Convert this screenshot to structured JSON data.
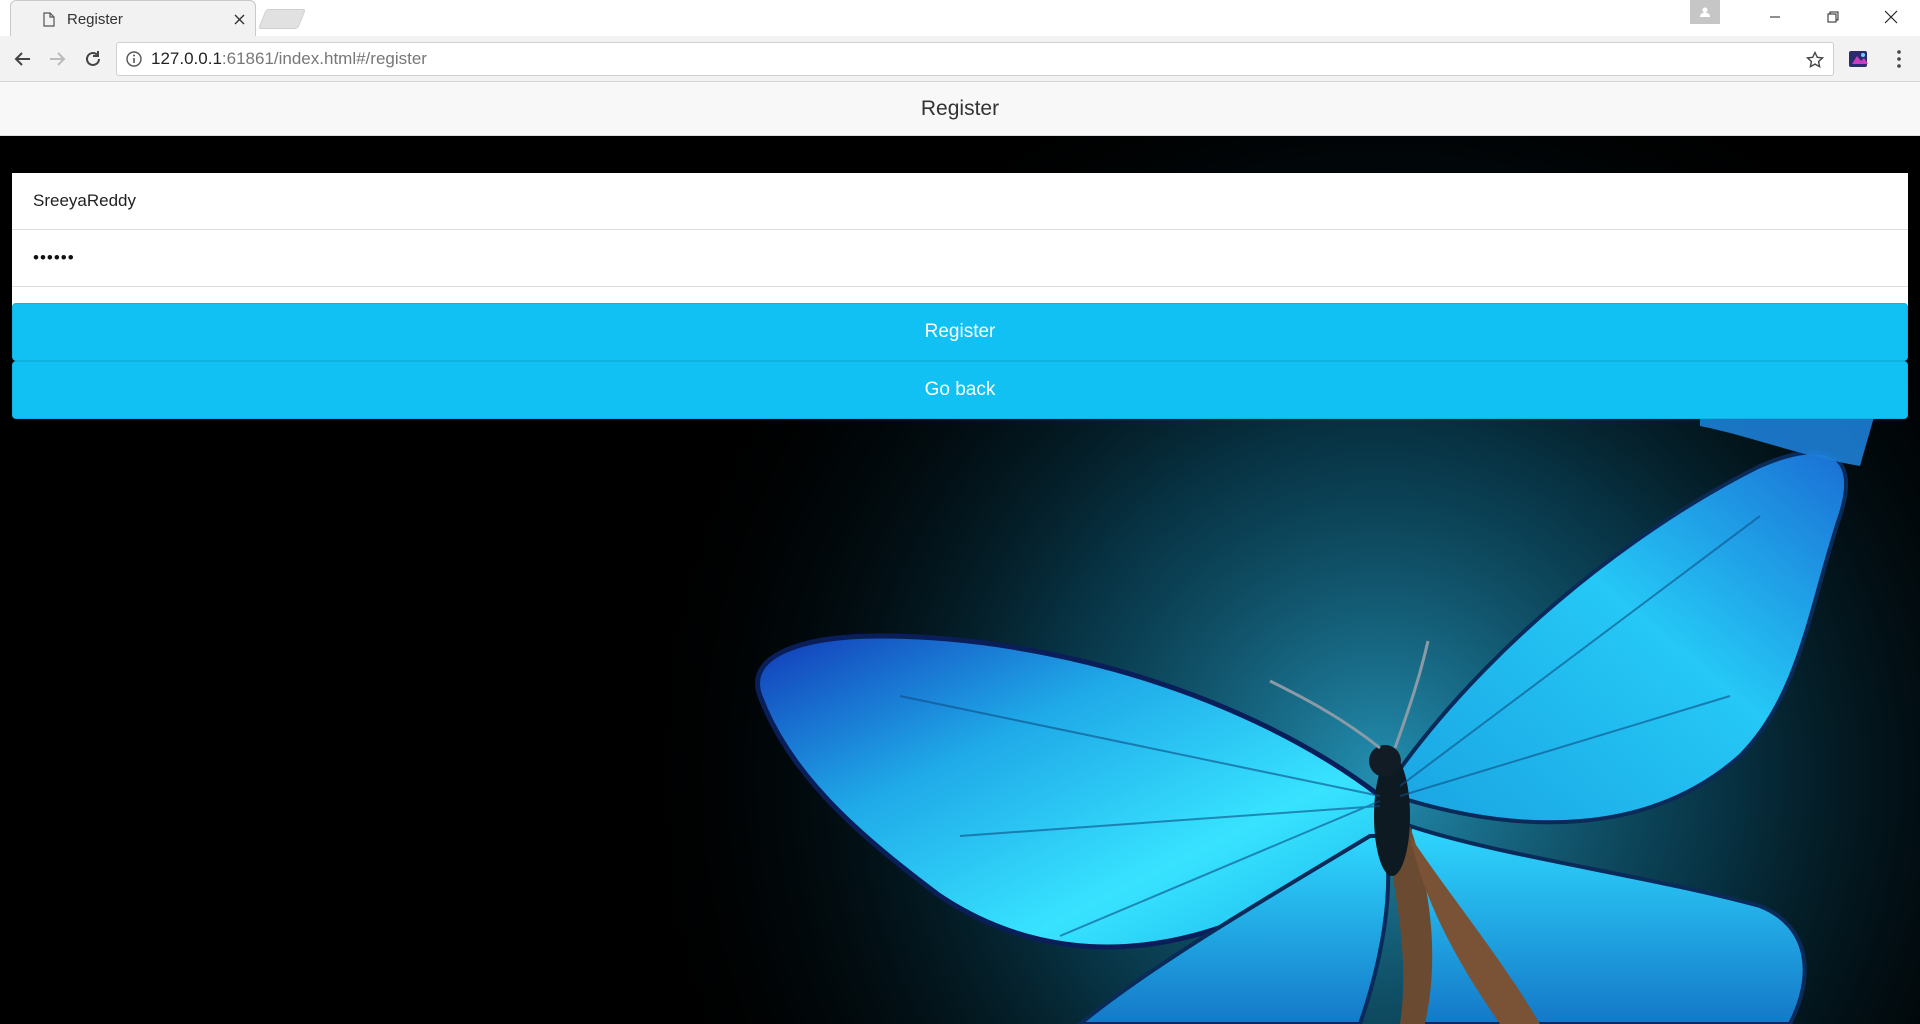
{
  "browser": {
    "tab": {
      "title": "Register",
      "icon": "document-icon"
    },
    "url": {
      "host": "127.0.0.1",
      "rest": ":61861/index.html#/register"
    }
  },
  "header": {
    "title": "Register"
  },
  "form": {
    "username": {
      "value": "SreeyaReddy"
    },
    "password": {
      "masked": "••••••"
    },
    "confirm_password": {
      "masked": "••••••"
    }
  },
  "buttons": {
    "register": "Register",
    "go_back": "Go back"
  },
  "colors": {
    "accent": "#11c1f3",
    "header_bg": "#f8f8f8",
    "page_bg": "#000000",
    "butterfly": "#19c3f0"
  }
}
